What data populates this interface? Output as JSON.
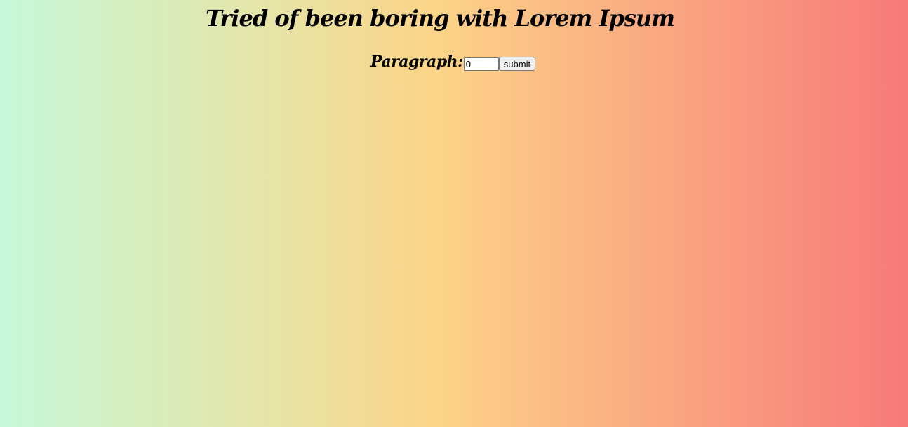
{
  "header": {
    "title": "Tried of been boring with Lorem Ipsum"
  },
  "form": {
    "label": "Paragraph:",
    "input_value": "0",
    "submit_label": "submit"
  },
  "colors": {
    "gradient_start": "#c6f8d8",
    "gradient_mid": "#fcd487",
    "gradient_end": "#f77a79"
  }
}
